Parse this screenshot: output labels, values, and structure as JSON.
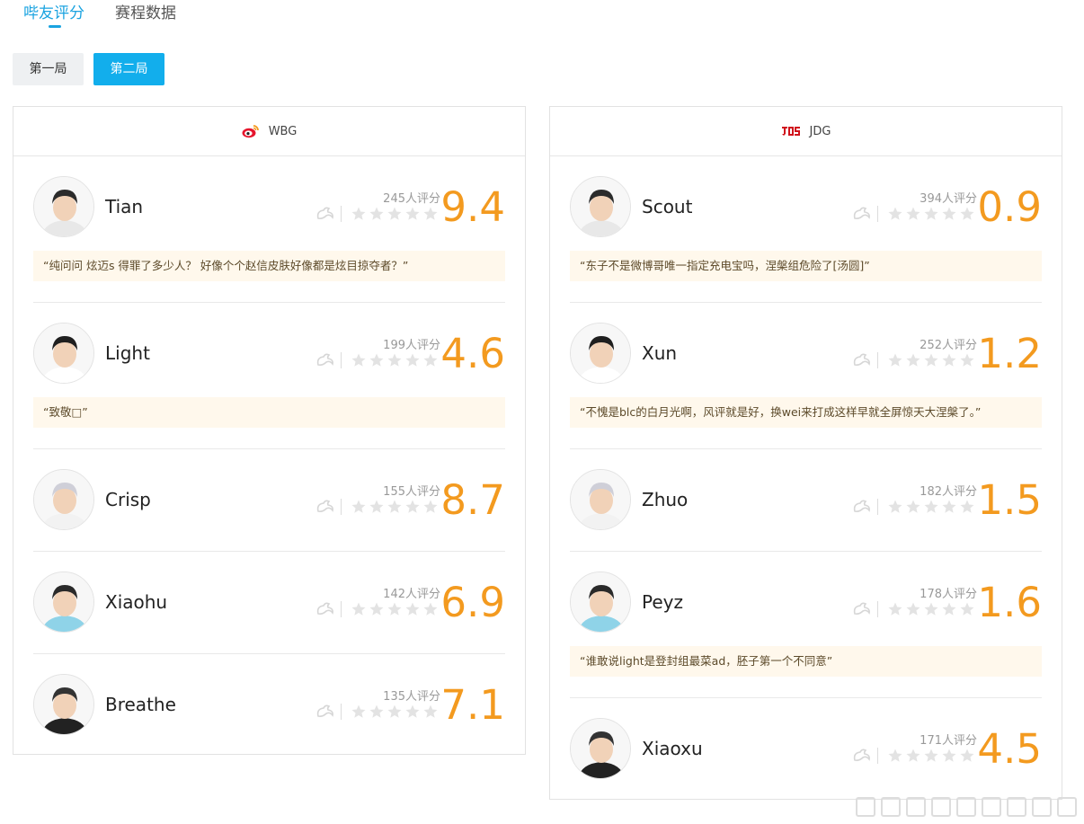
{
  "tabs": [
    {
      "label": "哔友评分",
      "active": true
    },
    {
      "label": "赛程数据",
      "active": false
    }
  ],
  "rounds": [
    {
      "label": "第一局",
      "active": false
    },
    {
      "label": "第二局",
      "active": true
    }
  ],
  "colors": {
    "accent": "#12aeec",
    "score": "#f39a1f",
    "comment_bg": "#fff8ec"
  },
  "wbg": {
    "team": "WBG",
    "players": [
      {
        "name": "Tian",
        "count": "245人评分",
        "score": "9.4",
        "comment": "“纯问问 炫迈s 得罪了多少人？ 好像个个赵信皮肤好像都是炫目掠夺者？”"
      },
      {
        "name": "Light",
        "count": "199人评分",
        "score": "4.6",
        "comment": "“致敬□”"
      },
      {
        "name": "Crisp",
        "count": "155人评分",
        "score": "8.7"
      },
      {
        "name": "Xiaohu",
        "count": "142人评分",
        "score": "6.9"
      },
      {
        "name": "Breathe",
        "count": "135人评分",
        "score": "7.1"
      }
    ]
  },
  "jdg": {
    "team": "JDG",
    "players": [
      {
        "name": "Scout",
        "count": "394人评分",
        "score": "0.9",
        "comment": "“东子不是微博哥唯一指定充电宝吗，涅槃组危险了[汤圆]”"
      },
      {
        "name": "Xun",
        "count": "252人评分",
        "score": "1.2",
        "comment": "“不愧是blc的白月光啊，风评就是好，换wei来打成这样早就全屏惊天大涅槃了。”"
      },
      {
        "name": "Zhuo",
        "count": "182人评分",
        "score": "1.5"
      },
      {
        "name": "Peyz",
        "count": "178人评分",
        "score": "1.6",
        "comment": "“谁敢说light是登封组最菜ad，胚子第一个不同意”"
      },
      {
        "name": "Xiaoxu",
        "count": "171人评分",
        "score": "4.5"
      }
    ]
  }
}
